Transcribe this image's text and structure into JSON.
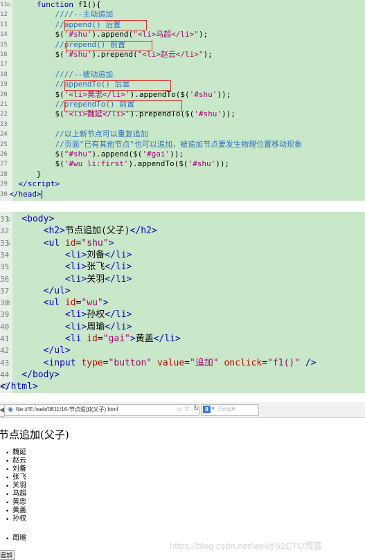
{
  "editor1": {
    "lines": [
      {
        "n": "11",
        "fold": true,
        "html": "        <span class='kw'>function</span> f1(){"
      },
      {
        "n": "12",
        "html": "            <span class='cm'>////--主动追加</span>"
      },
      {
        "n": "13",
        "html": "            <span class='cm'>//append()  后置</span>"
      },
      {
        "n": "14",
        "html": "            $(<span class='str'>'#shu'</span>).append(<span class='str'>\"&lt;li&gt;马超&lt;/li&gt;\"</span>);"
      },
      {
        "n": "15",
        "html": "            <span class='cm'>//prepend() 前置</span>"
      },
      {
        "n": "16",
        "html": "            $(<span class='str'>'#shu'</span>).prepend(<span class='str'>\"&lt;li&gt;赵云&lt;/li&gt;\"</span>);"
      },
      {
        "n": "17",
        "html": ""
      },
      {
        "n": "18",
        "html": "            <span class='cm'>////--被动追加</span>"
      },
      {
        "n": "19",
        "html": "            <span class='cm'>//appendTo()  后置</span>"
      },
      {
        "n": "20",
        "html": "            $(<span class='str'>'&lt;li&gt;黄忠&lt;/li&gt;'</span>).appendTo($(<span class='str'>'#shu'</span>));"
      },
      {
        "n": "21",
        "html": "            <span class='cm'>//prependTo()  前置</span>"
      },
      {
        "n": "22",
        "html": "            $(<span class='str'>'&lt;li&gt;魏延&lt;/li&gt;'</span>).prependTo($(<span class='str'>'#shu'</span>));"
      },
      {
        "n": "23",
        "html": ""
      },
      {
        "n": "24",
        "html": "            <span class='cm'>//以上新节点可以重复追加</span>"
      },
      {
        "n": "25",
        "html": "            <span class='cm'>//页面\"已有其他节点\"也可以追加，被追加节点要发生物理位置移动现象</span>"
      },
      {
        "n": "26",
        "html": "            $(<span class='str'>\"#shu\"</span>).append($(<span class='str'>'#gai'</span>));"
      },
      {
        "n": "27",
        "html": "            $(<span class='str'>'#wu li:first'</span>).appendTo($(<span class='str'>'#shu'</span>));"
      },
      {
        "n": "28",
        "html": "        }"
      },
      {
        "n": "29",
        "html": "    <span class='tag'>&lt;/script&gt;</span>"
      },
      {
        "n": "30",
        "html": "  <span class='tag'>&lt;/head&gt;</span><span class='cursor'></span>"
      }
    ]
  },
  "editor2": {
    "lines": [
      {
        "n": "31",
        "fold": true,
        "html": "    <span class='tag'>&lt;body&gt;</span>"
      },
      {
        "n": "32",
        "html": "        <span class='tag'>&lt;h2&gt;</span>节点追加(父子)<span class='tag'>&lt;/h2&gt;</span>"
      },
      {
        "n": "33",
        "fold": true,
        "html": "        <span class='tag'>&lt;ul</span> <span class='attr'>id</span>=<span class='str'>\"shu\"</span><span class='tag'>&gt;</span>"
      },
      {
        "n": "34",
        "html": "            <span class='tag'>&lt;li&gt;</span>刘备<span class='tag'>&lt;/li&gt;</span>"
      },
      {
        "n": "35",
        "html": "            <span class='tag'>&lt;li&gt;</span>张飞<span class='tag'>&lt;/li&gt;</span>"
      },
      {
        "n": "36",
        "html": "            <span class='tag'>&lt;li&gt;</span>关羽<span class='tag'>&lt;/li&gt;</span>"
      },
      {
        "n": "37",
        "html": "        <span class='tag'>&lt;/ul&gt;</span>"
      },
      {
        "n": "38",
        "fold": true,
        "html": "        <span class='tag'>&lt;ul</span> <span class='attr'>id</span>=<span class='str'>\"wu\"</span><span class='tag'>&gt;</span>"
      },
      {
        "n": "39",
        "html": "            <span class='tag'>&lt;li&gt;</span>孙权<span class='tag'>&lt;/li&gt;</span>"
      },
      {
        "n": "40",
        "html": "            <span class='tag'>&lt;li&gt;</span>周瑜<span class='tag'>&lt;/li&gt;</span>"
      },
      {
        "n": "41",
        "html": "            <span class='tag'>&lt;li</span> <span class='attr'>id</span>=<span class='str'>\"gai\"</span><span class='tag'>&gt;</span>黄盖<span class='tag'>&lt;/li&gt;</span>"
      },
      {
        "n": "42",
        "html": "        <span class='tag'>&lt;/ul&gt;</span>"
      },
      {
        "n": "43",
        "html": "        <span class='tag'>&lt;input</span> <span class='attr'>type</span>=<span class='str'>\"button\"</span> <span class='attr'>value</span>=<span class='str'>\"追加\"</span> <span class='attr'>onclick</span>=<span class='str'>\"f1()\"</span> <span class='tag'>/&gt;</span>"
      },
      {
        "n": "44",
        "html": "    <span class='tag'>&lt;/body&gt;</span>"
      },
      {
        "n": "45",
        "html": "<span class='tag'>&lt;/html&gt;</span>"
      }
    ]
  },
  "browser": {
    "url": "file:///E:/web/0811/16-节点追加(父子).html",
    "search_placeholder": "Google",
    "search_engine_letter": "8",
    "heading": "节点追加(父子)",
    "list_shu": [
      "魏延",
      "赵云",
      "刘备",
      "张飞",
      "关羽",
      "马超",
      "黄忠",
      "黄盖",
      "孙权"
    ],
    "list_wu": [
      "周瑜"
    ],
    "button_label": "追加",
    "watermark": "https://blog.csdn.net/wei@51CTO博客"
  },
  "icons": {
    "back": "back-arrow-icon",
    "site": "globe-icon",
    "bookmark": "star-icon",
    "reload": "reload-icon",
    "search_engine": "google-icon"
  }
}
